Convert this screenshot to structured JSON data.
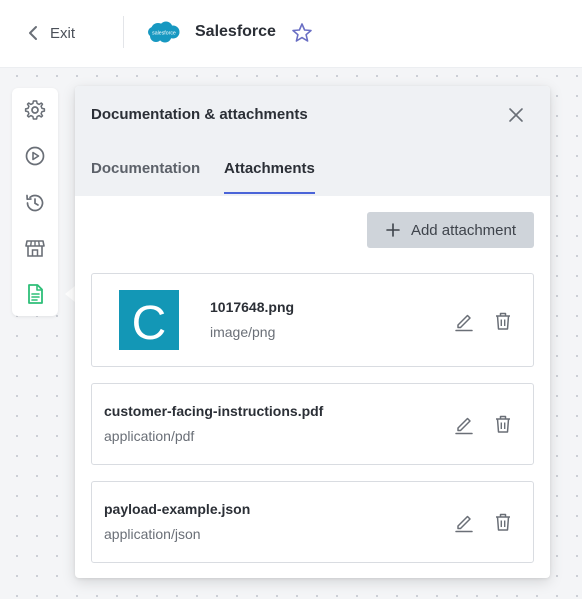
{
  "topbar": {
    "exit_label": "Exit",
    "app_name": "Salesforce",
    "app_logo_text": "salesforce",
    "brand_color": "#1798c1"
  },
  "rail": {
    "items": [
      "settings-icon",
      "play-circle-icon",
      "history-icon",
      "marketplace-icon",
      "document-icon"
    ],
    "active_item": "document-icon",
    "active_color": "#2ebf78"
  },
  "panel": {
    "title": "Documentation & attachments",
    "tabs": [
      {
        "label": "Documentation",
        "active": false
      },
      {
        "label": "Attachments",
        "active": true
      }
    ],
    "accent_color": "#4a64d8",
    "add_button_label": "Add attachment",
    "attachments": [
      {
        "name": "1017648.png",
        "type": "image/png",
        "thumbnail_letter": "C",
        "thumbnail_color": "#1397b6"
      },
      {
        "name": "customer-facing-instructions.pdf",
        "type": "application/pdf"
      },
      {
        "name": "payload-example.json",
        "type": "application/json"
      }
    ]
  }
}
